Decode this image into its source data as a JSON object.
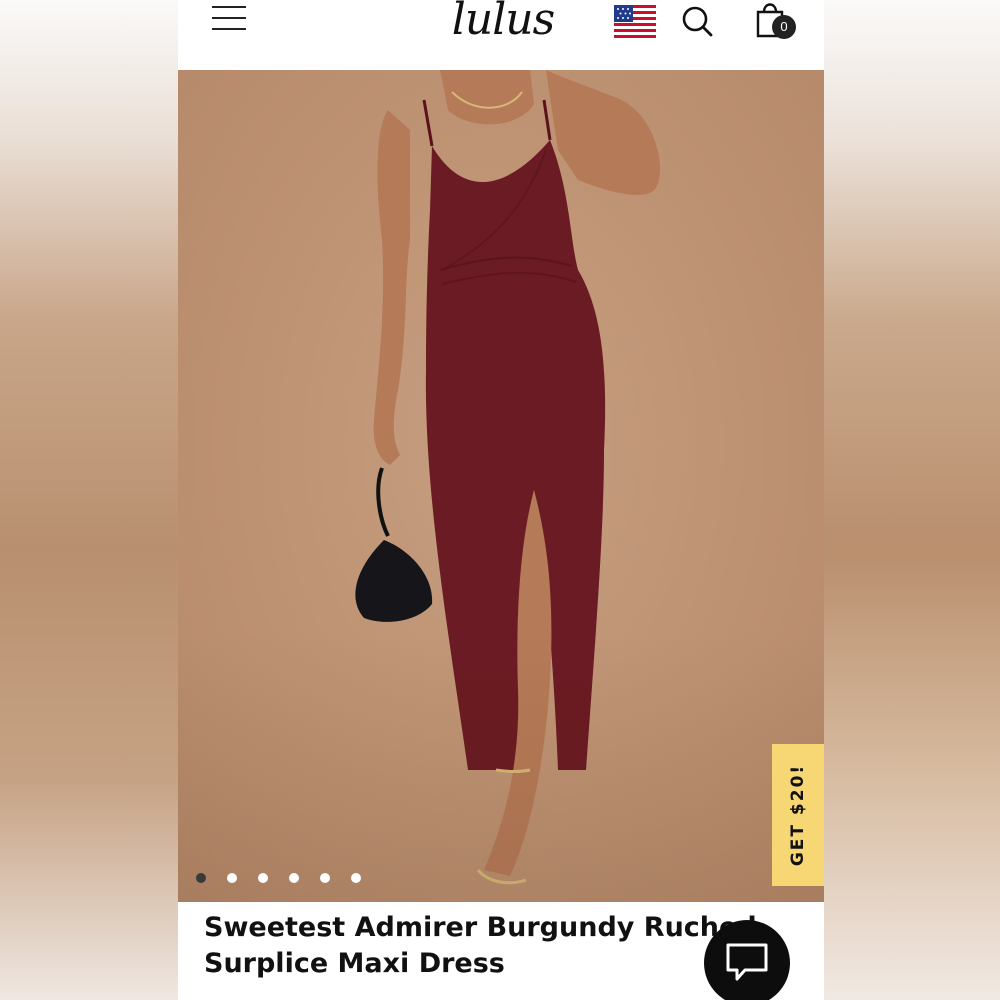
{
  "header": {
    "logo_text": "lulus",
    "menu_icon": "hamburger-menu-icon",
    "flag_icon": "us-flag-icon",
    "search_icon": "search-icon",
    "cart_icon": "shopping-bag-icon",
    "cart_count": "0"
  },
  "gallery": {
    "dot_count": 6,
    "active_index": 0
  },
  "promo": {
    "label": "GET $20!",
    "color": "#f7d774"
  },
  "product": {
    "title": "Sweetest Admirer Burgundy Ruched Surplice Maxi Dress"
  },
  "chat": {
    "icon": "chat-bubble-icon"
  },
  "colors": {
    "dress": "#6b1b23",
    "background": "#bd9272"
  }
}
